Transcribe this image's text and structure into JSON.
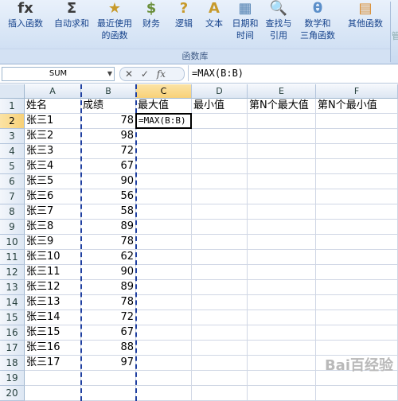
{
  "ribbon": {
    "buttons": [
      {
        "name": "insert-function",
        "l1": "插入函数",
        "l2": "",
        "icon": "fx"
      },
      {
        "name": "autosum",
        "l1": "自动求和",
        "l2": "",
        "icon": "Σ"
      },
      {
        "name": "recently-used",
        "l1": "最近使用",
        "l2": "的函数",
        "icon": "★"
      },
      {
        "name": "financial",
        "l1": "财务",
        "l2": "",
        "icon": "$"
      },
      {
        "name": "logical",
        "l1": "逻辑",
        "l2": "",
        "icon": "?"
      },
      {
        "name": "text",
        "l1": "文本",
        "l2": "",
        "icon": "A"
      },
      {
        "name": "date-time",
        "l1": "日期和",
        "l2": "时间",
        "icon": "▦"
      },
      {
        "name": "lookup-reference",
        "l1": "查找与",
        "l2": "引用",
        "icon": "🔍"
      },
      {
        "name": "math-trig",
        "l1": "数学和",
        "l2": "三角函数",
        "icon": "θ"
      },
      {
        "name": "more-functions",
        "l1": "其他函数",
        "l2": "",
        "icon": "▤"
      }
    ],
    "group_label": "函数库",
    "trailing_label": "管"
  },
  "formula_bar": {
    "name_box": "SUM",
    "cancel": "✕",
    "enter": "✓",
    "fx": "fx",
    "formula": "=MAX(B:B)"
  },
  "columns": [
    "A",
    "B",
    "C",
    "D",
    "E",
    "F"
  ],
  "rows": [
    {
      "n": "1",
      "a": "姓名",
      "b": "成绩",
      "c": "最大值",
      "d": "最小值",
      "e": "第N个最大值",
      "f": "第N个最小值"
    },
    {
      "n": "2",
      "a": "张三1",
      "b": "78",
      "c": "=MAX(B:B)",
      "d": "",
      "e": "",
      "f": ""
    },
    {
      "n": "3",
      "a": "张三2",
      "b": "98",
      "c": "",
      "d": "",
      "e": "",
      "f": ""
    },
    {
      "n": "4",
      "a": "张三3",
      "b": "72",
      "c": "",
      "d": "",
      "e": "",
      "f": ""
    },
    {
      "n": "5",
      "a": "张三4",
      "b": "67",
      "c": "",
      "d": "",
      "e": "",
      "f": ""
    },
    {
      "n": "6",
      "a": "张三5",
      "b": "90",
      "c": "",
      "d": "",
      "e": "",
      "f": ""
    },
    {
      "n": "7",
      "a": "张三6",
      "b": "56",
      "c": "",
      "d": "",
      "e": "",
      "f": ""
    },
    {
      "n": "8",
      "a": "张三7",
      "b": "58",
      "c": "",
      "d": "",
      "e": "",
      "f": ""
    },
    {
      "n": "9",
      "a": "张三8",
      "b": "89",
      "c": "",
      "d": "",
      "e": "",
      "f": ""
    },
    {
      "n": "10",
      "a": "张三9",
      "b": "78",
      "c": "",
      "d": "",
      "e": "",
      "f": ""
    },
    {
      "n": "11",
      "a": "张三10",
      "b": "62",
      "c": "",
      "d": "",
      "e": "",
      "f": ""
    },
    {
      "n": "12",
      "a": "张三11",
      "b": "90",
      "c": "",
      "d": "",
      "e": "",
      "f": ""
    },
    {
      "n": "13",
      "a": "张三12",
      "b": "89",
      "c": "",
      "d": "",
      "e": "",
      "f": ""
    },
    {
      "n": "14",
      "a": "张三13",
      "b": "78",
      "c": "",
      "d": "",
      "e": "",
      "f": ""
    },
    {
      "n": "15",
      "a": "张三14",
      "b": "72",
      "c": "",
      "d": "",
      "e": "",
      "f": ""
    },
    {
      "n": "16",
      "a": "张三15",
      "b": "67",
      "c": "",
      "d": "",
      "e": "",
      "f": ""
    },
    {
      "n": "17",
      "a": "张三16",
      "b": "88",
      "c": "",
      "d": "",
      "e": "",
      "f": ""
    },
    {
      "n": "18",
      "a": "张三17",
      "b": "97",
      "c": "",
      "d": "",
      "e": "",
      "f": ""
    },
    {
      "n": "19",
      "a": "",
      "b": "",
      "c": "",
      "d": "",
      "e": "",
      "f": ""
    },
    {
      "n": "20",
      "a": "",
      "b": "",
      "c": "",
      "d": "",
      "e": "",
      "f": ""
    }
  ],
  "selection": {
    "active_col": "C",
    "active_row": "2"
  },
  "watermark": "Bai百经验",
  "colors": {
    "accent": "#15428b",
    "marquee": "#1f3fa0",
    "selected_header": "#f8d178"
  }
}
